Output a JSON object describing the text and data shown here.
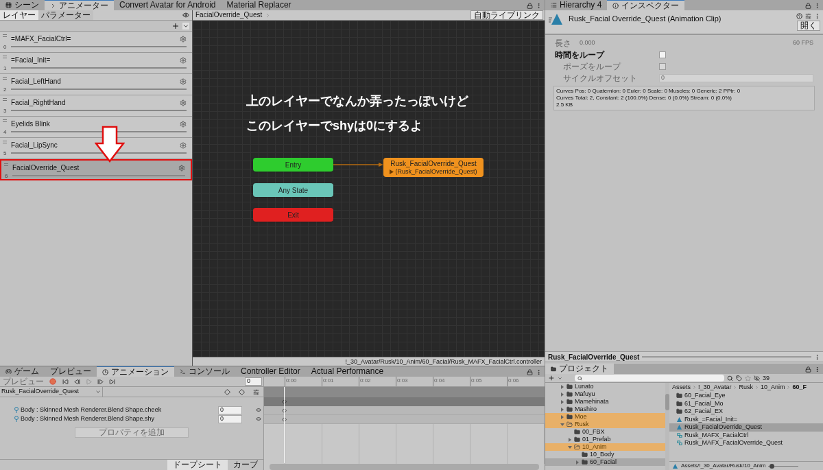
{
  "main_tabs": [
    {
      "label": "シーン",
      "selected": false
    },
    {
      "label": "アニメーター",
      "selected": true
    },
    {
      "label": "Convert Avatar for Android",
      "selected": false
    },
    {
      "label": "Material Replacer",
      "selected": false
    }
  ],
  "animator": {
    "subtabs": [
      {
        "label": "レイヤー",
        "selected": true
      },
      {
        "label": "パラメーター",
        "selected": false
      }
    ],
    "layers": [
      {
        "name": "=MAFX_FacialCtrl=",
        "index": "0",
        "selected": false,
        "outlined": false
      },
      {
        "name": "=Facial_Init=",
        "index": "1",
        "selected": false,
        "outlined": false
      },
      {
        "name": "Facial_LeftHand",
        "index": "2",
        "selected": false,
        "outlined": false
      },
      {
        "name": "Facial_RightHand",
        "index": "3",
        "selected": false,
        "outlined": false
      },
      {
        "name": "Eyelids Blink",
        "index": "4",
        "selected": false,
        "outlined": false
      },
      {
        "name": "Facial_LipSync",
        "index": "5",
        "selected": false,
        "outlined": false
      },
      {
        "name": "FacialOverride_Quest",
        "index": "6",
        "selected": true,
        "outlined": true
      }
    ],
    "breadcrumb": "FacialOverride_Quest",
    "live_link_button": "自動ライブリンク",
    "comment_lines": [
      "上のレイヤーでなんか弄ったっぽいけど",
      "このレイヤーでshyは0にするよ"
    ],
    "nodes": [
      {
        "kind": "entry",
        "label": "Entry"
      },
      {
        "kind": "any",
        "label": "Any State"
      },
      {
        "kind": "exit",
        "label": "Exit"
      },
      {
        "kind": "state",
        "label": "Rusk_FacialOverride_Quest",
        "motion": "(Rusk_FacialOverride_Quest)"
      }
    ],
    "controller_path": "!_30_Avatar/Rusk/10_Anim/60_Facial/Rusk_MAFX_FacialCtrl.controller"
  },
  "bottom_tabs": [
    {
      "label": "ゲーム",
      "selected": false
    },
    {
      "label": "プレビュー",
      "selected": false
    },
    {
      "label": "アニメーション",
      "selected": true
    },
    {
      "label": "コンソール",
      "selected": false
    },
    {
      "label": "Controller Editor",
      "selected": false
    },
    {
      "label": "Actual Performance",
      "selected": false
    }
  ],
  "animation": {
    "preview_button": "プレビュー",
    "frame": "0",
    "clip": "Rusk_FacialOverride_Quest",
    "properties": [
      {
        "label": "Body : Skinned Mesh Renderer.Blend Shape.cheek",
        "value": "0"
      },
      {
        "label": "Body : Skinned Mesh Renderer.Blend Shape.shy",
        "value": "0"
      }
    ],
    "add_property_button": "プロパティを追加",
    "time_ticks": [
      "0:00",
      "0:01",
      "0:02",
      "0:03",
      "0:04",
      "0:05",
      "0:06"
    ],
    "view_tabs": [
      {
        "label": "ドープシート",
        "selected": true
      },
      {
        "label": "カーブ",
        "selected": false
      }
    ]
  },
  "inspector": {
    "tabs": [
      {
        "label": "Hierarchy 4",
        "selected": false
      },
      {
        "label": "インスペクター",
        "selected": true
      }
    ],
    "title": "Rusk_Facial Override_Quest (Animation Clip)",
    "open_button": "開く",
    "length_label": "長さ",
    "length_value": "0.000",
    "fps": "60 FPS",
    "fields": [
      {
        "kind": "checkbox",
        "label": "時間をループ",
        "checked": false,
        "disabled": false
      },
      {
        "kind": "checkbox",
        "label": "ポーズをループ",
        "checked": false,
        "disabled": true
      },
      {
        "kind": "number",
        "label": "サイクルオフセット",
        "value": "0",
        "disabled": true
      }
    ],
    "stats": [
      "Curves Pos: 0 Quaternion: 0 Euler: 0 Scale: 0 Muscles: 0 Generic: 2 PPtr: 0",
      "Curves Total: 2, Constant: 2 (100.0%) Dense: 0 (0.0%) Stream: 0 (0.0%)",
      "2.5 KB"
    ],
    "preview_title": "Rusk_FacialOverride_Quest"
  },
  "project": {
    "tab": "プロジェクト",
    "hidden_count": "39",
    "tree": [
      {
        "label": "Lunato",
        "expanded": false,
        "highlighted": false,
        "selected": false
      },
      {
        "label": "Mafuyu",
        "expanded": false,
        "highlighted": false,
        "selected": false
      },
      {
        "label": "Mamehinata",
        "expanded": false,
        "highlighted": false,
        "selected": false
      },
      {
        "label": "Mashiro",
        "expanded": false,
        "highlighted": false,
        "selected": false
      },
      {
        "label": "Moe",
        "expanded": false,
        "highlighted": true,
        "selected": false
      },
      {
        "label": "Rusk",
        "expanded": true,
        "highlighted": true,
        "selected": false,
        "children": [
          {
            "label": "00_FBX",
            "highlighted": false,
            "selected": false
          },
          {
            "label": "01_Prefab",
            "expanded": false,
            "highlighted": false,
            "selected": false
          },
          {
            "label": "10_Anim",
            "expanded": true,
            "highlighted": true,
            "selected": false,
            "children": [
              {
                "label": "10_Body",
                "highlighted": false,
                "selected": false
              },
              {
                "label": "60_Facial",
                "expanded": false,
                "highlighted": false,
                "selected": true
              }
            ]
          }
        ]
      }
    ],
    "breadcrumb": [
      "Assets",
      "!_30_Avatar",
      "Rusk",
      "10_Anim",
      "60_F"
    ],
    "items": [
      {
        "kind": "folder",
        "label": "60_Facial_Eye",
        "selected": false
      },
      {
        "kind": "folder",
        "label": "61_Facial_Mo",
        "selected": false
      },
      {
        "kind": "folder",
        "label": "62_Facial_EX",
        "selected": false
      },
      {
        "kind": "clip",
        "label": "Rusk_=Facial_Init=",
        "selected": false
      },
      {
        "kind": "clip",
        "label": "Rusk_FacialOverride_Quest",
        "selected": true
      },
      {
        "kind": "controller",
        "label": "Rusk_MAFX_FacialCtrl",
        "selected": false
      },
      {
        "kind": "controller",
        "label": "Rusk_MAFX_FacialOverride_Quest",
        "selected": false
      }
    ],
    "path": "Assets/!_30_Avatar/Rusk/10_Anim",
    "size_slider": {
      "level": 0.05
    }
  }
}
